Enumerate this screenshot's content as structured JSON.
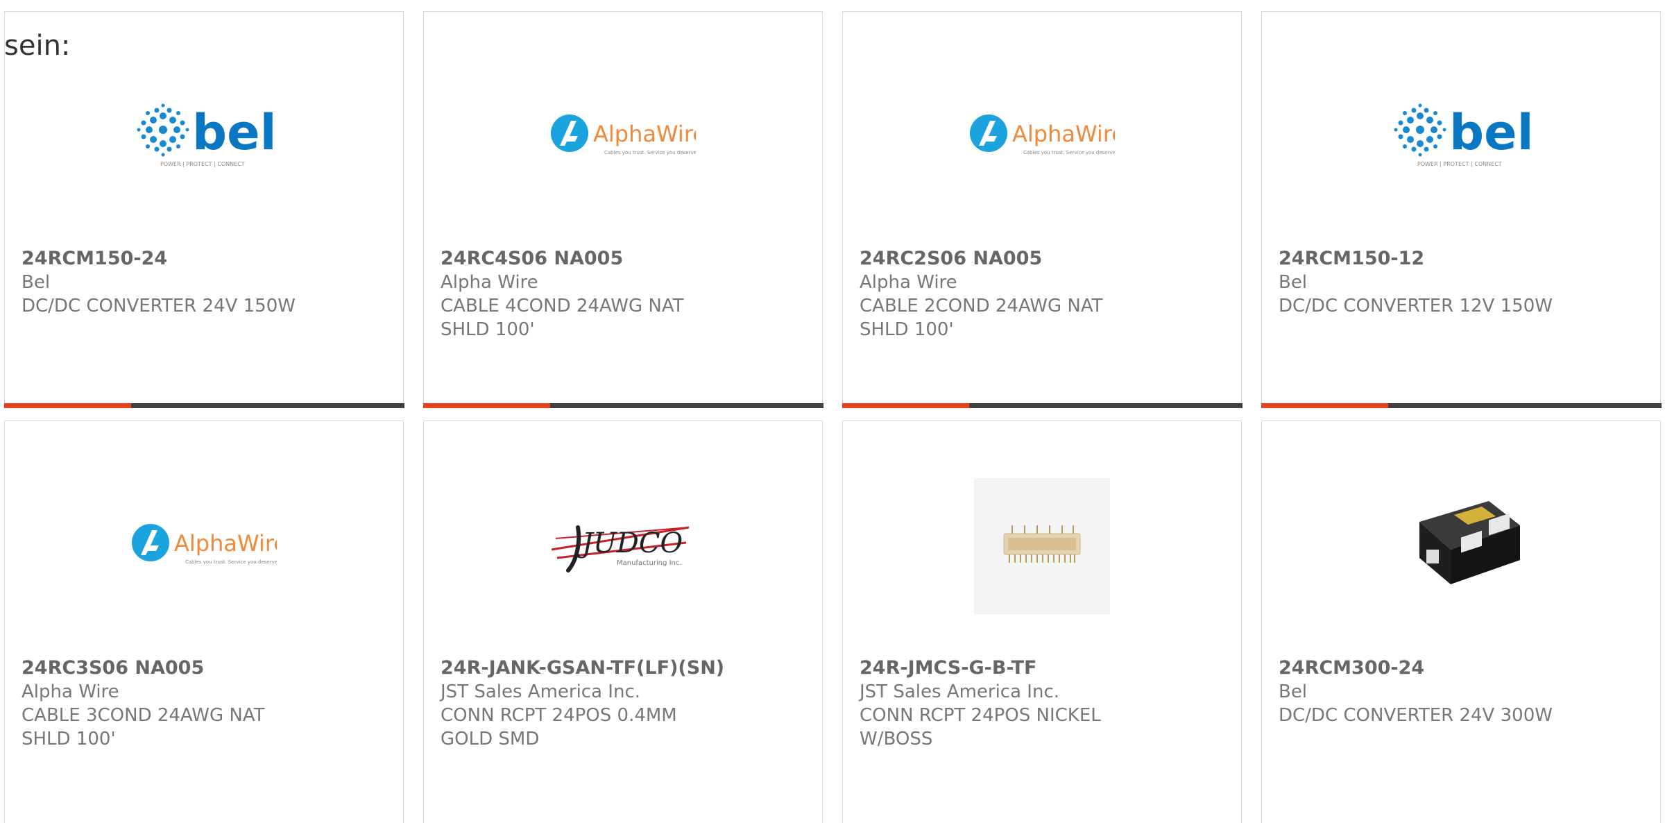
{
  "lead_text": "sein:",
  "products": [
    {
      "part_number": "24RCM150-24",
      "manufacturer": "Bel",
      "description": "DC/DC CONVERTER 24V 150W",
      "logo": "bel-logo"
    },
    {
      "part_number": "24RC4S06 NA005",
      "manufacturer": "Alpha Wire",
      "description": "CABLE 4COND 24AWG NAT SHLD 100'",
      "logo": "alphawire-logo"
    },
    {
      "part_number": "24RC2S06 NA005",
      "manufacturer": "Alpha Wire",
      "description": "CABLE 2COND 24AWG NAT SHLD 100'",
      "logo": "alphawire-logo"
    },
    {
      "part_number": "24RCM150-12",
      "manufacturer": "Bel",
      "description": "DC/DC CONVERTER 12V 150W",
      "logo": "bel-logo"
    },
    {
      "part_number": "24RC3S06 NA005",
      "manufacturer": "Alpha Wire",
      "description": "CABLE 3COND 24AWG NAT SHLD 100'",
      "logo": "alphawire-logo"
    },
    {
      "part_number": "24R-JANK-GSAN-TF(LF)(SN)",
      "manufacturer": "JST Sales America Inc.",
      "description": "CONN RCPT 24POS 0.4MM GOLD SMD",
      "logo": "judco-logo"
    },
    {
      "part_number": "24R-JMCS-G-B-TF",
      "manufacturer": "JST Sales America Inc.",
      "description": "CONN RCPT 24POS NICKEL W/BOSS",
      "logo": "connector-photo"
    },
    {
      "part_number": "24RCM300-24",
      "manufacturer": "Bel",
      "description": "DC/DC CONVERTER 24V 300W",
      "logo": "converter-photo"
    }
  ],
  "logos": {
    "bel": {
      "wordmark": "bel",
      "tagline": "POWER | PROTECT | CONNECT"
    },
    "alphawire": {
      "wordmark": "AlphaWire",
      "tagline": "Cables you trust. Service you deserve."
    },
    "judco": {
      "wordmark": "JUDCO",
      "tagline": "Manufacturing Inc."
    }
  },
  "colors": {
    "accent": "#e8421c",
    "bar": "#404040",
    "bel_blue": "#0a77c2",
    "alpha_blue": "#1ba3dd",
    "alpha_orange": "#f0893a",
    "text": "#666666"
  }
}
